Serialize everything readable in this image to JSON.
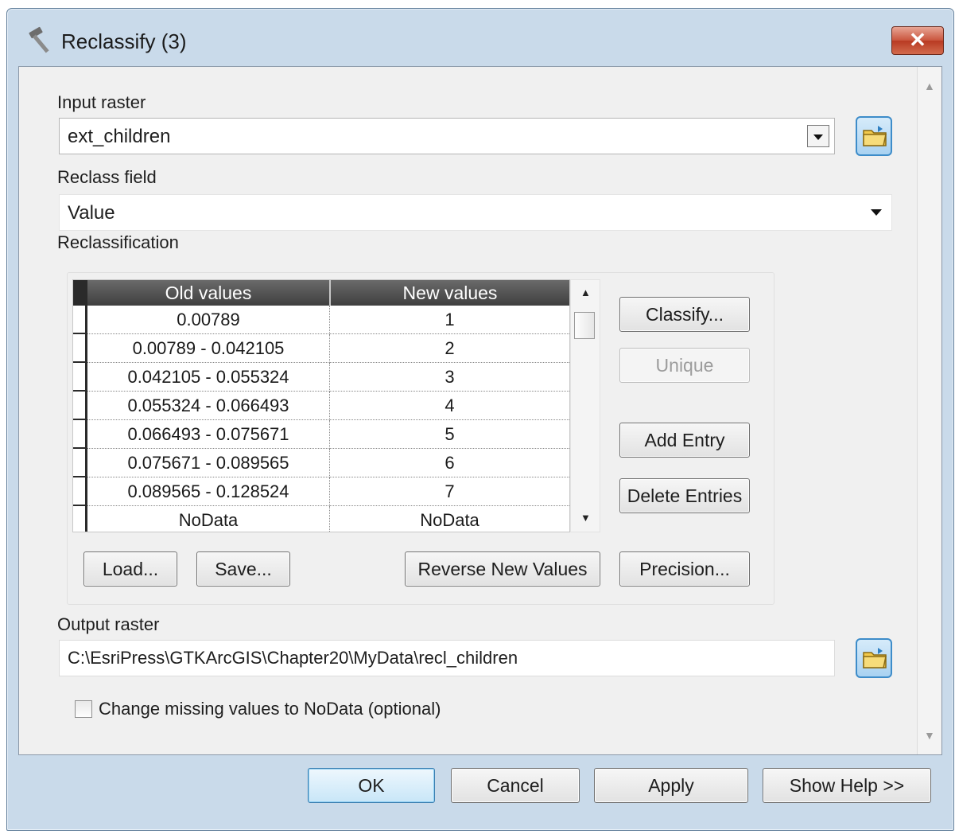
{
  "window": {
    "title": "Reclassify (3)",
    "close_label": "✕"
  },
  "input_raster": {
    "label": "Input raster",
    "value": "ext_children"
  },
  "reclass_field": {
    "label": "Reclass field",
    "value": "Value"
  },
  "reclassification": {
    "label": "Reclassification",
    "columns": [
      "Old values",
      "New values"
    ],
    "rows": [
      {
        "old": "0.00789",
        "new": "1"
      },
      {
        "old": "0.00789 - 0.042105",
        "new": "2"
      },
      {
        "old": "0.042105 - 0.055324",
        "new": "3"
      },
      {
        "old": "0.055324 - 0.066493",
        "new": "4"
      },
      {
        "old": "0.066493 - 0.075671",
        "new": "5"
      },
      {
        "old": "0.075671 - 0.089565",
        "new": "6"
      },
      {
        "old": "0.089565 - 0.128524",
        "new": "7"
      },
      {
        "old": "NoData",
        "new": "NoData"
      }
    ],
    "buttons": {
      "classify": "Classify...",
      "unique": "Unique",
      "add_entry": "Add Entry",
      "delete_entries": "Delete Entries",
      "load": "Load...",
      "save": "Save...",
      "reverse": "Reverse New Values",
      "precision": "Precision..."
    }
  },
  "output_raster": {
    "label": "Output raster",
    "value": "C:\\EsriPress\\GTKArcGIS\\Chapter20\\MyData\\recl_children"
  },
  "missing_values": {
    "label": "Change missing values to NoData (optional)",
    "checked": false
  },
  "footer": {
    "ok": "OK",
    "cancel": "Cancel",
    "apply": "Apply",
    "help": "Show Help >>"
  }
}
